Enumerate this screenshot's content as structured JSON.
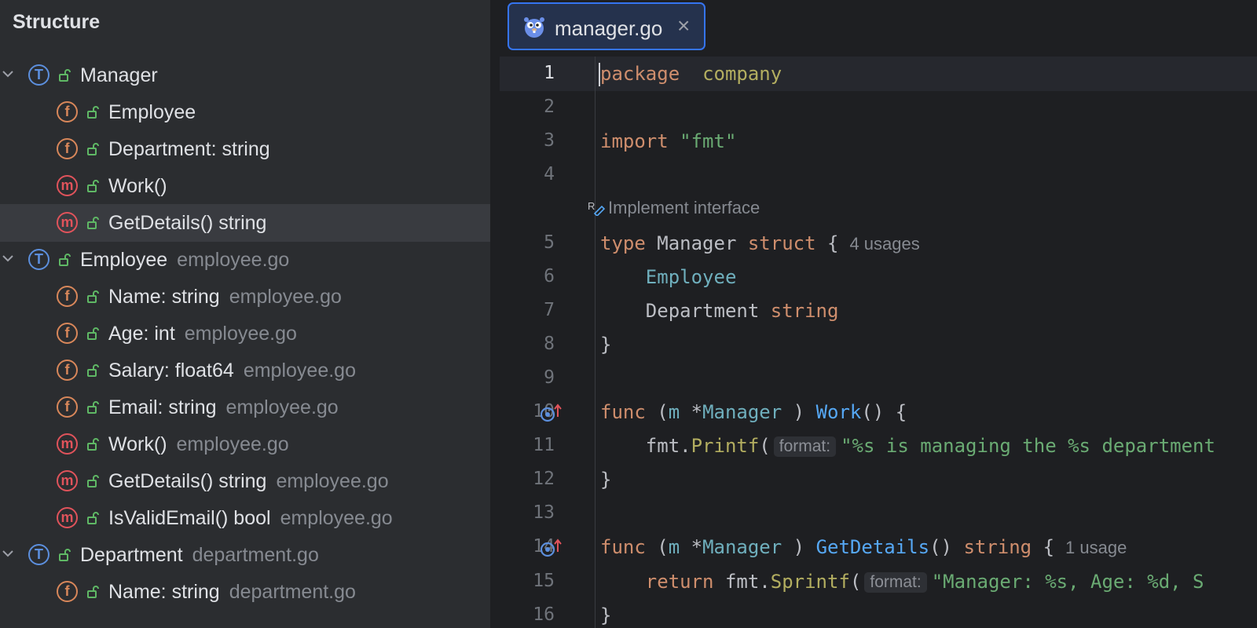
{
  "structure": {
    "title": "Structure",
    "items": [
      {
        "kind": "T",
        "label": "Manager",
        "file": "",
        "indent": 0,
        "expandable": true,
        "selected": false
      },
      {
        "kind": "f",
        "label": "Employee",
        "file": "",
        "indent": 1,
        "expandable": false,
        "selected": false
      },
      {
        "kind": "f",
        "label": "Department: string",
        "file": "",
        "indent": 1,
        "expandable": false,
        "selected": false
      },
      {
        "kind": "m",
        "label": "Work()",
        "file": "",
        "indent": 1,
        "expandable": false,
        "selected": false
      },
      {
        "kind": "m",
        "label": "GetDetails() string",
        "file": "",
        "indent": 1,
        "expandable": false,
        "selected": true
      },
      {
        "kind": "T",
        "label": "Employee",
        "file": "employee.go",
        "indent": 0,
        "expandable": true,
        "selected": false
      },
      {
        "kind": "f",
        "label": "Name: string",
        "file": "employee.go",
        "indent": 1,
        "expandable": false,
        "selected": false
      },
      {
        "kind": "f",
        "label": "Age: int",
        "file": "employee.go",
        "indent": 1,
        "expandable": false,
        "selected": false
      },
      {
        "kind": "f",
        "label": "Salary: float64",
        "file": "employee.go",
        "indent": 1,
        "expandable": false,
        "selected": false
      },
      {
        "kind": "f",
        "label": "Email: string",
        "file": "employee.go",
        "indent": 1,
        "expandable": false,
        "selected": false
      },
      {
        "kind": "m",
        "label": "Work()",
        "file": "employee.go",
        "indent": 1,
        "expandable": false,
        "selected": false
      },
      {
        "kind": "m",
        "label": "GetDetails() string",
        "file": "employee.go",
        "indent": 1,
        "expandable": false,
        "selected": false
      },
      {
        "kind": "m",
        "label": "IsValidEmail() bool",
        "file": "employee.go",
        "indent": 1,
        "expandable": false,
        "selected": false
      },
      {
        "kind": "T",
        "label": "Department",
        "file": "department.go",
        "indent": 0,
        "expandable": true,
        "selected": false
      },
      {
        "kind": "f",
        "label": "Name: string",
        "file": "department.go",
        "indent": 1,
        "expandable": false,
        "selected": false
      }
    ]
  },
  "editor": {
    "tab": {
      "label": "manager.go",
      "icon": "gopher-icon"
    },
    "lens": "Implement interface",
    "lines": [
      {
        "type": "code",
        "num": "1",
        "current": true,
        "tokens": [
          [
            "kw",
            "package"
          ],
          [
            "",
            "  "
          ],
          [
            "pkg",
            "company"
          ]
        ]
      },
      {
        "type": "code",
        "num": "2",
        "tokens": []
      },
      {
        "type": "code",
        "num": "3",
        "tokens": [
          [
            "kw",
            "import"
          ],
          [
            "",
            " "
          ],
          [
            "str",
            "\"fmt\""
          ]
        ]
      },
      {
        "type": "code",
        "num": "4",
        "tokens": []
      },
      {
        "type": "lens"
      },
      {
        "type": "code",
        "num": "5",
        "hint": "4 usages",
        "tokens": [
          [
            "kw",
            "type"
          ],
          [
            "",
            " Manager "
          ],
          [
            "kw",
            "struct"
          ],
          [
            "",
            " {"
          ]
        ]
      },
      {
        "type": "code",
        "num": "6",
        "tokens": [
          [
            "",
            "    "
          ],
          [
            "emb",
            "Employee"
          ]
        ]
      },
      {
        "type": "code",
        "num": "7",
        "tokens": [
          [
            "",
            "    Department "
          ],
          [
            "kw",
            "string"
          ]
        ]
      },
      {
        "type": "code",
        "num": "8",
        "tokens": [
          [
            "",
            "}"
          ]
        ]
      },
      {
        "type": "code",
        "num": "9",
        "tokens": []
      },
      {
        "type": "code",
        "num": "10",
        "gutter": "implements-up-icon",
        "tokens": [
          [
            "kw",
            "func"
          ],
          [
            "",
            " ("
          ],
          [
            "prm",
            "m"
          ],
          [
            "",
            " *"
          ],
          [
            "typ",
            "Manager"
          ],
          [
            "",
            " ) "
          ],
          [
            "fn",
            "Work"
          ],
          [
            "",
            "() {"
          ]
        ]
      },
      {
        "type": "code",
        "num": "11",
        "inlay": "format:",
        "tokens": [
          [
            "",
            "    fmt."
          ],
          [
            "pkg",
            "Printf"
          ],
          [
            "",
            "("
          ],
          [
            "inlay",
            ""
          ],
          [
            "str",
            "\"%s is managing the %s department"
          ]
        ]
      },
      {
        "type": "code",
        "num": "12",
        "tokens": [
          [
            "",
            "}"
          ]
        ]
      },
      {
        "type": "code",
        "num": "13",
        "tokens": []
      },
      {
        "type": "code",
        "num": "14",
        "gutter": "implements-up-icon",
        "hint": "1 usage",
        "tokens": [
          [
            "kw",
            "func"
          ],
          [
            "",
            " ("
          ],
          [
            "prm",
            "m"
          ],
          [
            "",
            " *"
          ],
          [
            "typ",
            "Manager"
          ],
          [
            "",
            " ) "
          ],
          [
            "fn",
            "GetDetails"
          ],
          [
            "",
            "() "
          ],
          [
            "kw",
            "string"
          ],
          [
            "",
            " {"
          ]
        ]
      },
      {
        "type": "code",
        "num": "15",
        "inlay": "format:",
        "tokens": [
          [
            "",
            "    "
          ],
          [
            "kw",
            "return"
          ],
          [
            "",
            " fmt."
          ],
          [
            "pkg",
            "Sprintf"
          ],
          [
            "",
            "("
          ],
          [
            "inlay",
            ""
          ],
          [
            "str",
            "\"Manager: %s, Age: %d, S"
          ]
        ]
      },
      {
        "type": "code",
        "num": "16",
        "tokens": [
          [
            "",
            "}"
          ]
        ]
      }
    ]
  },
  "colors": {
    "accent": "#3574f0",
    "selection": "#393b40",
    "keyword": "#cf8e6d",
    "string": "#6aab73",
    "function": "#56a8f5"
  }
}
